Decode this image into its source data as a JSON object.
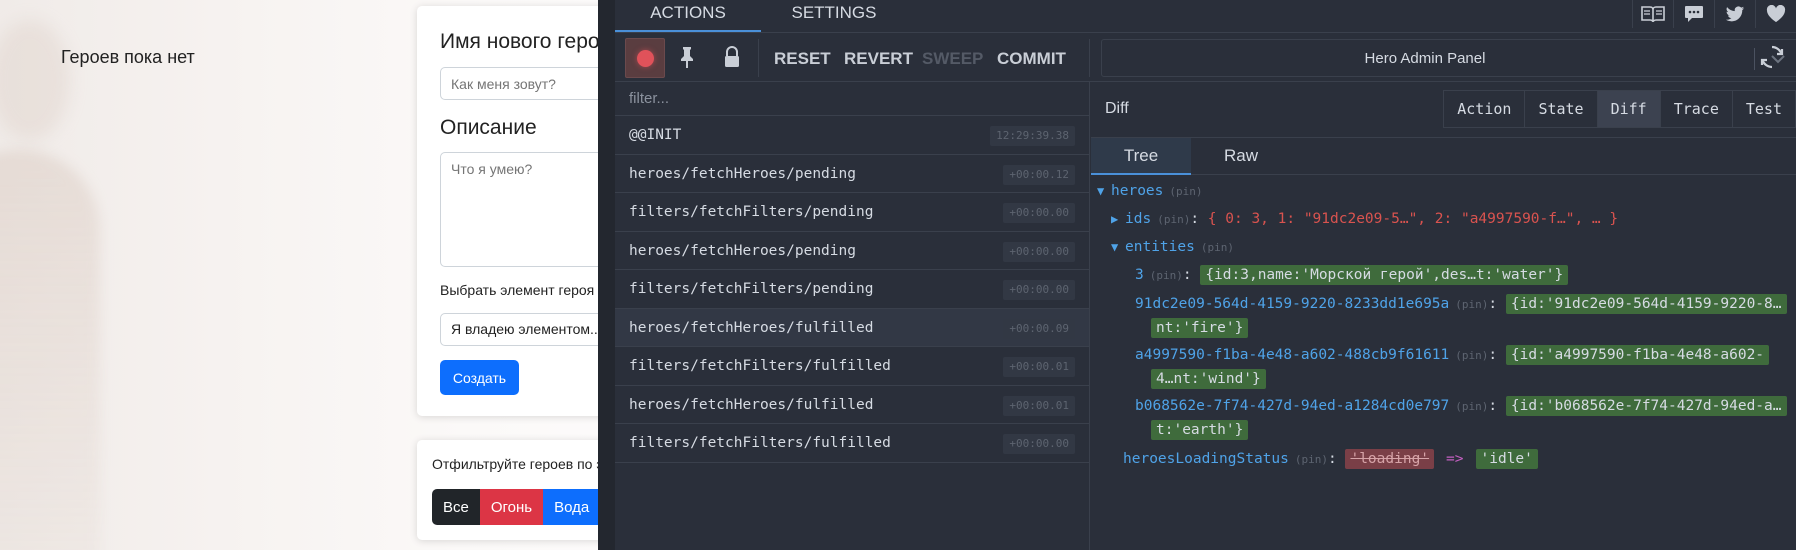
{
  "app": {
    "no_heroes_text": "Героев пока нет",
    "form": {
      "name_label": "Имя нового героя",
      "name_placeholder": "Как меня зовут?",
      "description_label": "Описание",
      "description_placeholder": "Что я умею?",
      "element_label": "Выбрать элемент героя",
      "element_select_value": "Я владею элементом...",
      "create_button": "Создать"
    },
    "filters": {
      "title": "Отфильтруйте героев по элементам",
      "buttons": [
        "Все",
        "Огонь",
        "Вода"
      ]
    }
  },
  "devtools": {
    "tabs": [
      "ACTIONS",
      "SETTINGS"
    ],
    "active_tab": "ACTIONS",
    "top_icons": [
      "book-icon",
      "chat-icon",
      "twitter-icon",
      "heart-icon"
    ],
    "toolbar": {
      "reset": "RESET",
      "revert": "REVERT",
      "sweep": "SWEEP",
      "commit": "COMMIT"
    },
    "instance": "Hero Admin Panel",
    "filter_placeholder": "filter...",
    "actions": [
      {
        "name": "@@INIT",
        "time": "12:29:39.38"
      },
      {
        "name": "heroes/fetchHeroes/pending",
        "time": "+00:00.12"
      },
      {
        "name": "filters/fetchFilters/pending",
        "time": "+00:00.00"
      },
      {
        "name": "heroes/fetchHeroes/pending",
        "time": "+00:00.00"
      },
      {
        "name": "filters/fetchFilters/pending",
        "time": "+00:00.00"
      },
      {
        "name": "heroes/fetchHeroes/fulfilled",
        "time": "+00:00.09"
      },
      {
        "name": "filters/fetchFilters/fulfilled",
        "time": "+00:00.01"
      },
      {
        "name": "heroes/fetchHeroes/fulfilled",
        "time": "+00:00.01"
      },
      {
        "name": "filters/fetchFilters/fulfilled",
        "time": "+00:00.00"
      }
    ],
    "panel": {
      "title": "Diff",
      "monitor_tabs": [
        "Action",
        "State",
        "Diff",
        "Trace",
        "Test"
      ],
      "active_monitor": "Diff",
      "sub_tabs": [
        "Tree",
        "Raw"
      ],
      "active_sub_tab": "Tree",
      "pin": "(pin)",
      "tree": {
        "root_key": "heroes",
        "ids_key": "ids",
        "ids_value": "{ 0: 3, 1: \"91dc2e09-5…\", 2: \"a4997590-f…\", … }",
        "entities_key": "entities",
        "entities": [
          {
            "key": "3",
            "value": "{id:3,name:'Морской герой',des…t:'water'}",
            "cont": ""
          },
          {
            "key": "91dc2e09-564d-4159-9220-8233dd1e695a",
            "value": "{id:'91dc2e09-564d-4159-9220-8…",
            "cont": "nt:'fire'}"
          },
          {
            "key": "a4997590-f1ba-4e48-a602-488cb9f61611",
            "value": "{id:'a4997590-f1ba-4e48-a602-",
            "cont": "4…nt:'wind'}"
          },
          {
            "key": "b068562e-7f74-427d-94ed-a1284cd0e797",
            "value": "{id:'b068562e-7f74-427d-94ed-a…",
            "cont": "t:'earth'}"
          }
        ],
        "status_key": "heroesLoadingStatus",
        "status_old": "'loading'",
        "status_arrow": "=>",
        "status_new": "'idle'"
      }
    }
  }
}
